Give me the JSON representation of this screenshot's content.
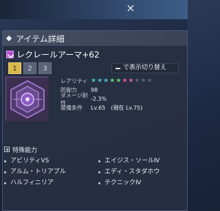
{
  "window": {
    "close_glyph": "×"
  },
  "panel": {
    "title": "アイテム詳細",
    "item_name": "レクレールアーマ+62",
    "tabs": [
      "1",
      "2",
      "3"
    ],
    "active_tab": "1",
    "toggle_hint": "で表示切り替え",
    "type_icon": "armor-type-icon",
    "accent_color": "#b54fd0"
  },
  "stats": {
    "rarity_label": "レアリティ",
    "rarity_stars": {
      "teal": 3,
      "green": 2,
      "pink": 2,
      "gray": 3
    },
    "defense_label": "防御力",
    "defense_value": "98",
    "damage_resist_label": "ダメージ耐性",
    "damage_resist_value": "-2.3%",
    "equip_label": "装備条件",
    "equip_value": "Lv.65　(現在 Lv.75)"
  },
  "abilities": {
    "header": "特殊能力",
    "list": [
      "アビリティⅤS",
      "エイジス・ソールⅣ",
      "アルム・トリアプル",
      "エディ・スタダホウ",
      "ハルフィニリア",
      "テクニックⅣ"
    ]
  }
}
